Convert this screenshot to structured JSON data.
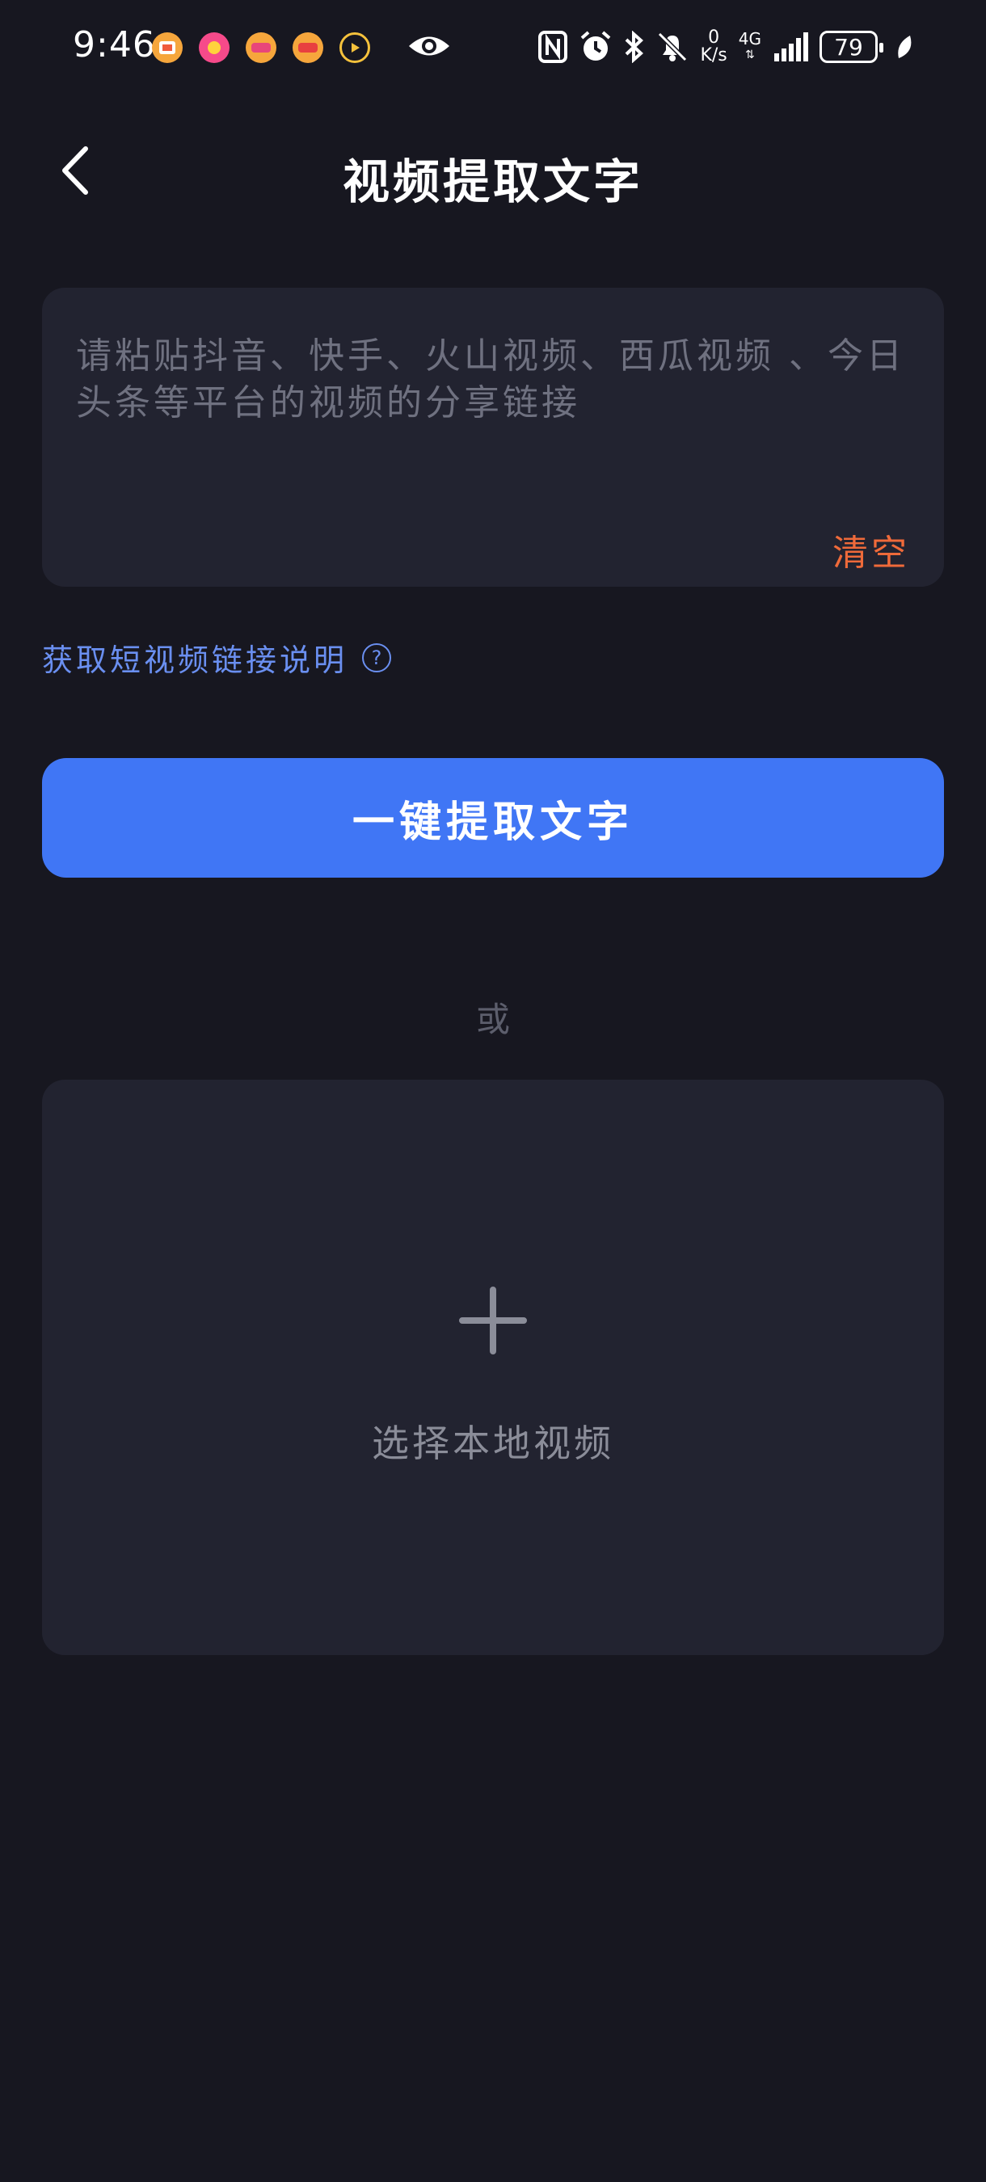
{
  "status_bar": {
    "time": "9:46",
    "net_speed_value": "0",
    "net_speed_unit": "K/s",
    "network": "4G",
    "battery": "79"
  },
  "header": {
    "title": "视频提取文字"
  },
  "input": {
    "placeholder": "请粘贴抖音、快手、火山视频、西瓜视频 、今日头条等平台的视频的分享链接",
    "clear_label": "清空"
  },
  "help": {
    "link_label": "获取短视频链接说明",
    "icon_glyph": "?"
  },
  "primary_button": {
    "label": "一键提取文字"
  },
  "divider": {
    "or_label": "或"
  },
  "upload": {
    "label": "选择本地视频"
  },
  "colors": {
    "background": "#171720",
    "card": "#222330",
    "accent_blue": "#4076f5",
    "link_blue": "#6a8ff0",
    "clear_orange": "#ef6a3a"
  }
}
